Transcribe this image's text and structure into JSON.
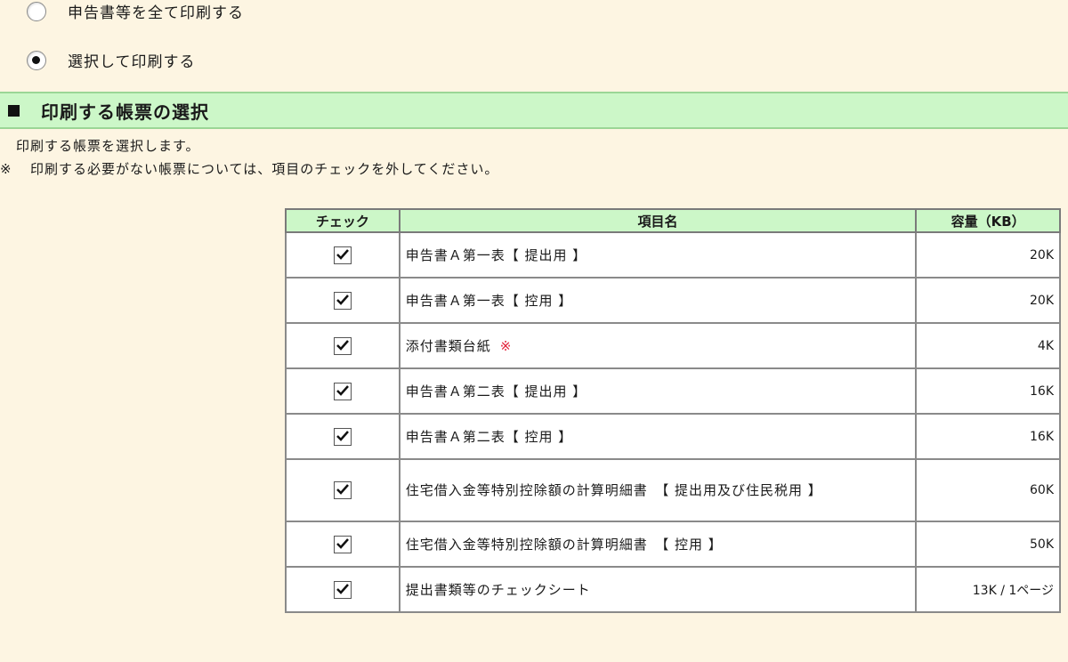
{
  "print_options": [
    {
      "label": "申告書等を全て印刷する",
      "selected": false
    },
    {
      "label": "選択して印刷する",
      "selected": true
    }
  ],
  "section": {
    "title": "印刷する帳票の選択"
  },
  "description": {
    "line1": "印刷する帳票を選択します。",
    "note_mark": "※",
    "line2": "印刷する必要がない帳票については、項目のチェックを外してください。"
  },
  "table": {
    "headers": {
      "check": "チェック",
      "name": "項目名",
      "size": "容量（KB）"
    },
    "rows": [
      {
        "checked": true,
        "name": "申告書Ａ第一表【 提出用 】",
        "size": "20K"
      },
      {
        "checked": true,
        "name": "申告書Ａ第一表【 控用 】",
        "size": "20K"
      },
      {
        "checked": true,
        "name": "添付書類台紙",
        "note": "※",
        "size": "4K"
      },
      {
        "checked": true,
        "name": "申告書Ａ第二表【 提出用 】",
        "size": "16K"
      },
      {
        "checked": true,
        "name": "申告書Ａ第二表【 控用 】",
        "size": "16K"
      },
      {
        "checked": true,
        "name": "住宅借入金等特別控除額の計算明細書　【 提出用及び住民税用 】",
        "size": "60K"
      },
      {
        "checked": true,
        "name": "住宅借入金等特別控除額の計算明細書　【 控用 】",
        "size": "50K"
      },
      {
        "checked": true,
        "name": "提出書類等のチェックシート",
        "size": "13K / 1ページ"
      }
    ]
  },
  "colors": {
    "background": "#fdf5e2",
    "header_green": "#ccf7c8",
    "note_red": "#e2233a"
  }
}
